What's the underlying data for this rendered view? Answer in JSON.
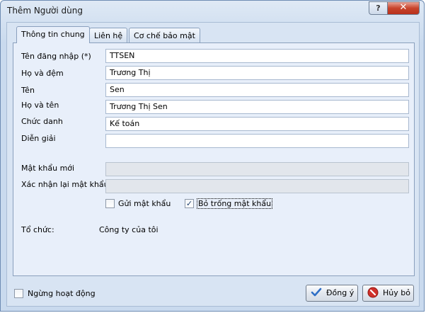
{
  "window": {
    "title": "Thêm Người dùng",
    "help_label": "?",
    "close_label": "✕"
  },
  "tabs": [
    {
      "label": "Thông tin chung",
      "active": true
    },
    {
      "label": "Liên hệ",
      "active": false
    },
    {
      "label": "Cơ chế bảo mật",
      "active": false
    }
  ],
  "form": {
    "username": {
      "label": "Tên đăng nhập (*)",
      "value": "TTSEN"
    },
    "last_middle_name": {
      "label": "Họ và đệm",
      "value": "Trương Thị"
    },
    "first_name": {
      "label": "Tên",
      "value": "Sen"
    },
    "full_name": {
      "label": "Họ và tên",
      "value": "Trương Thị Sen"
    },
    "job_title": {
      "label": "Chức danh",
      "value": "Kế toán"
    },
    "description": {
      "label": "Diễn giải",
      "value": ""
    },
    "new_password": {
      "label": "Mật khẩu mới",
      "value": ""
    },
    "confirm_password": {
      "label": "Xác nhận lại mật khẩu",
      "value": ""
    },
    "send_password": {
      "label": "Gửi mật khẩu",
      "checked": false
    },
    "blank_password": {
      "label": "Bỏ trống mật khẩu",
      "checked": true
    },
    "organization": {
      "label": "Tổ chức:",
      "value": "Công ty của tôi"
    }
  },
  "footer": {
    "inactive": {
      "label": "Ngừng hoạt động",
      "checked": false
    },
    "ok_label": "Đồng ý",
    "cancel_label": "Hủy bỏ"
  },
  "colors": {
    "ok_icon": "#2f6fc6",
    "cancel_icon": "#d0302a",
    "close_button": "#c8442c"
  }
}
